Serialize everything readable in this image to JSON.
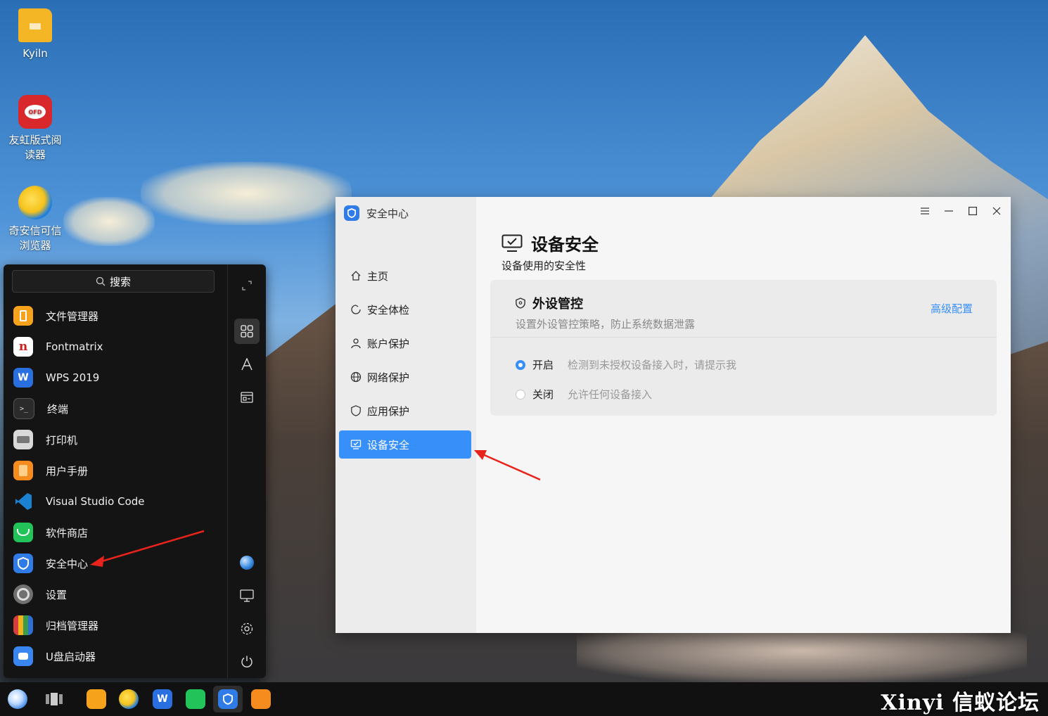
{
  "desktop": {
    "icons": [
      {
        "label": "Kyiln"
      },
      {
        "label_line1": "友虹版式阅",
        "label_line2": "读器"
      },
      {
        "label_line1": "奇安信可信",
        "label_line2": "浏览器"
      }
    ]
  },
  "start_menu": {
    "search_label": "搜索",
    "apps": [
      {
        "label": "文件管理器",
        "icon": "folder-icon",
        "color": "#f7a21b"
      },
      {
        "label": "Fontmatrix",
        "icon": "fontmatrix-icon",
        "color": "#c9201e"
      },
      {
        "label": "WPS 2019",
        "icon": "wps-icon",
        "color": "#2a6fe0"
      },
      {
        "label": "终端",
        "icon": "terminal-icon",
        "color": "#2b2b2b"
      },
      {
        "label": "打印机",
        "icon": "printer-icon",
        "color": "#d9d9d9"
      },
      {
        "label": "用户手册",
        "icon": "manual-icon",
        "color": "#f78c1e"
      },
      {
        "label": "Visual Studio Code",
        "icon": "vscode-icon",
        "color": "#1b82d1"
      },
      {
        "label": "软件商店",
        "icon": "store-icon",
        "color": "#22c45a"
      },
      {
        "label": "安全中心",
        "icon": "security-center-icon",
        "color": "#2f7be8"
      },
      {
        "label": "设置",
        "icon": "settings-icon",
        "color": "#707070"
      },
      {
        "label": "归档管理器",
        "icon": "archive-icon",
        "color": "#d63d3d"
      },
      {
        "label": "U盘启动器",
        "icon": "usb-boot-icon",
        "color": "#3a86f0"
      }
    ]
  },
  "window": {
    "app_title": "安全中心",
    "nav": [
      {
        "label": "主页",
        "icon": "home-icon"
      },
      {
        "label": "安全体检",
        "icon": "scan-icon"
      },
      {
        "label": "账户保护",
        "icon": "user-icon"
      },
      {
        "label": "网络保护",
        "icon": "globe-icon"
      },
      {
        "label": "应用保护",
        "icon": "shield-icon"
      },
      {
        "label": "设备安全",
        "icon": "monitor-check-icon",
        "active": true
      }
    ],
    "page_title": "设备安全",
    "page_subtitle": "设备使用的安全性",
    "card": {
      "title": "外设管控",
      "description": "设置外设管控策略，防止系统数据泄露",
      "link": "高级配置",
      "options": [
        {
          "label": "开启",
          "hint": "检测到未授权设备接入时，请提示我",
          "selected": true
        },
        {
          "label": "关闭",
          "hint": "允许任何设备接入",
          "selected": false
        }
      ]
    }
  },
  "taskbar": {
    "watermark": "Xinyi 信蚁论坛"
  },
  "accent_color": "#3790fa"
}
